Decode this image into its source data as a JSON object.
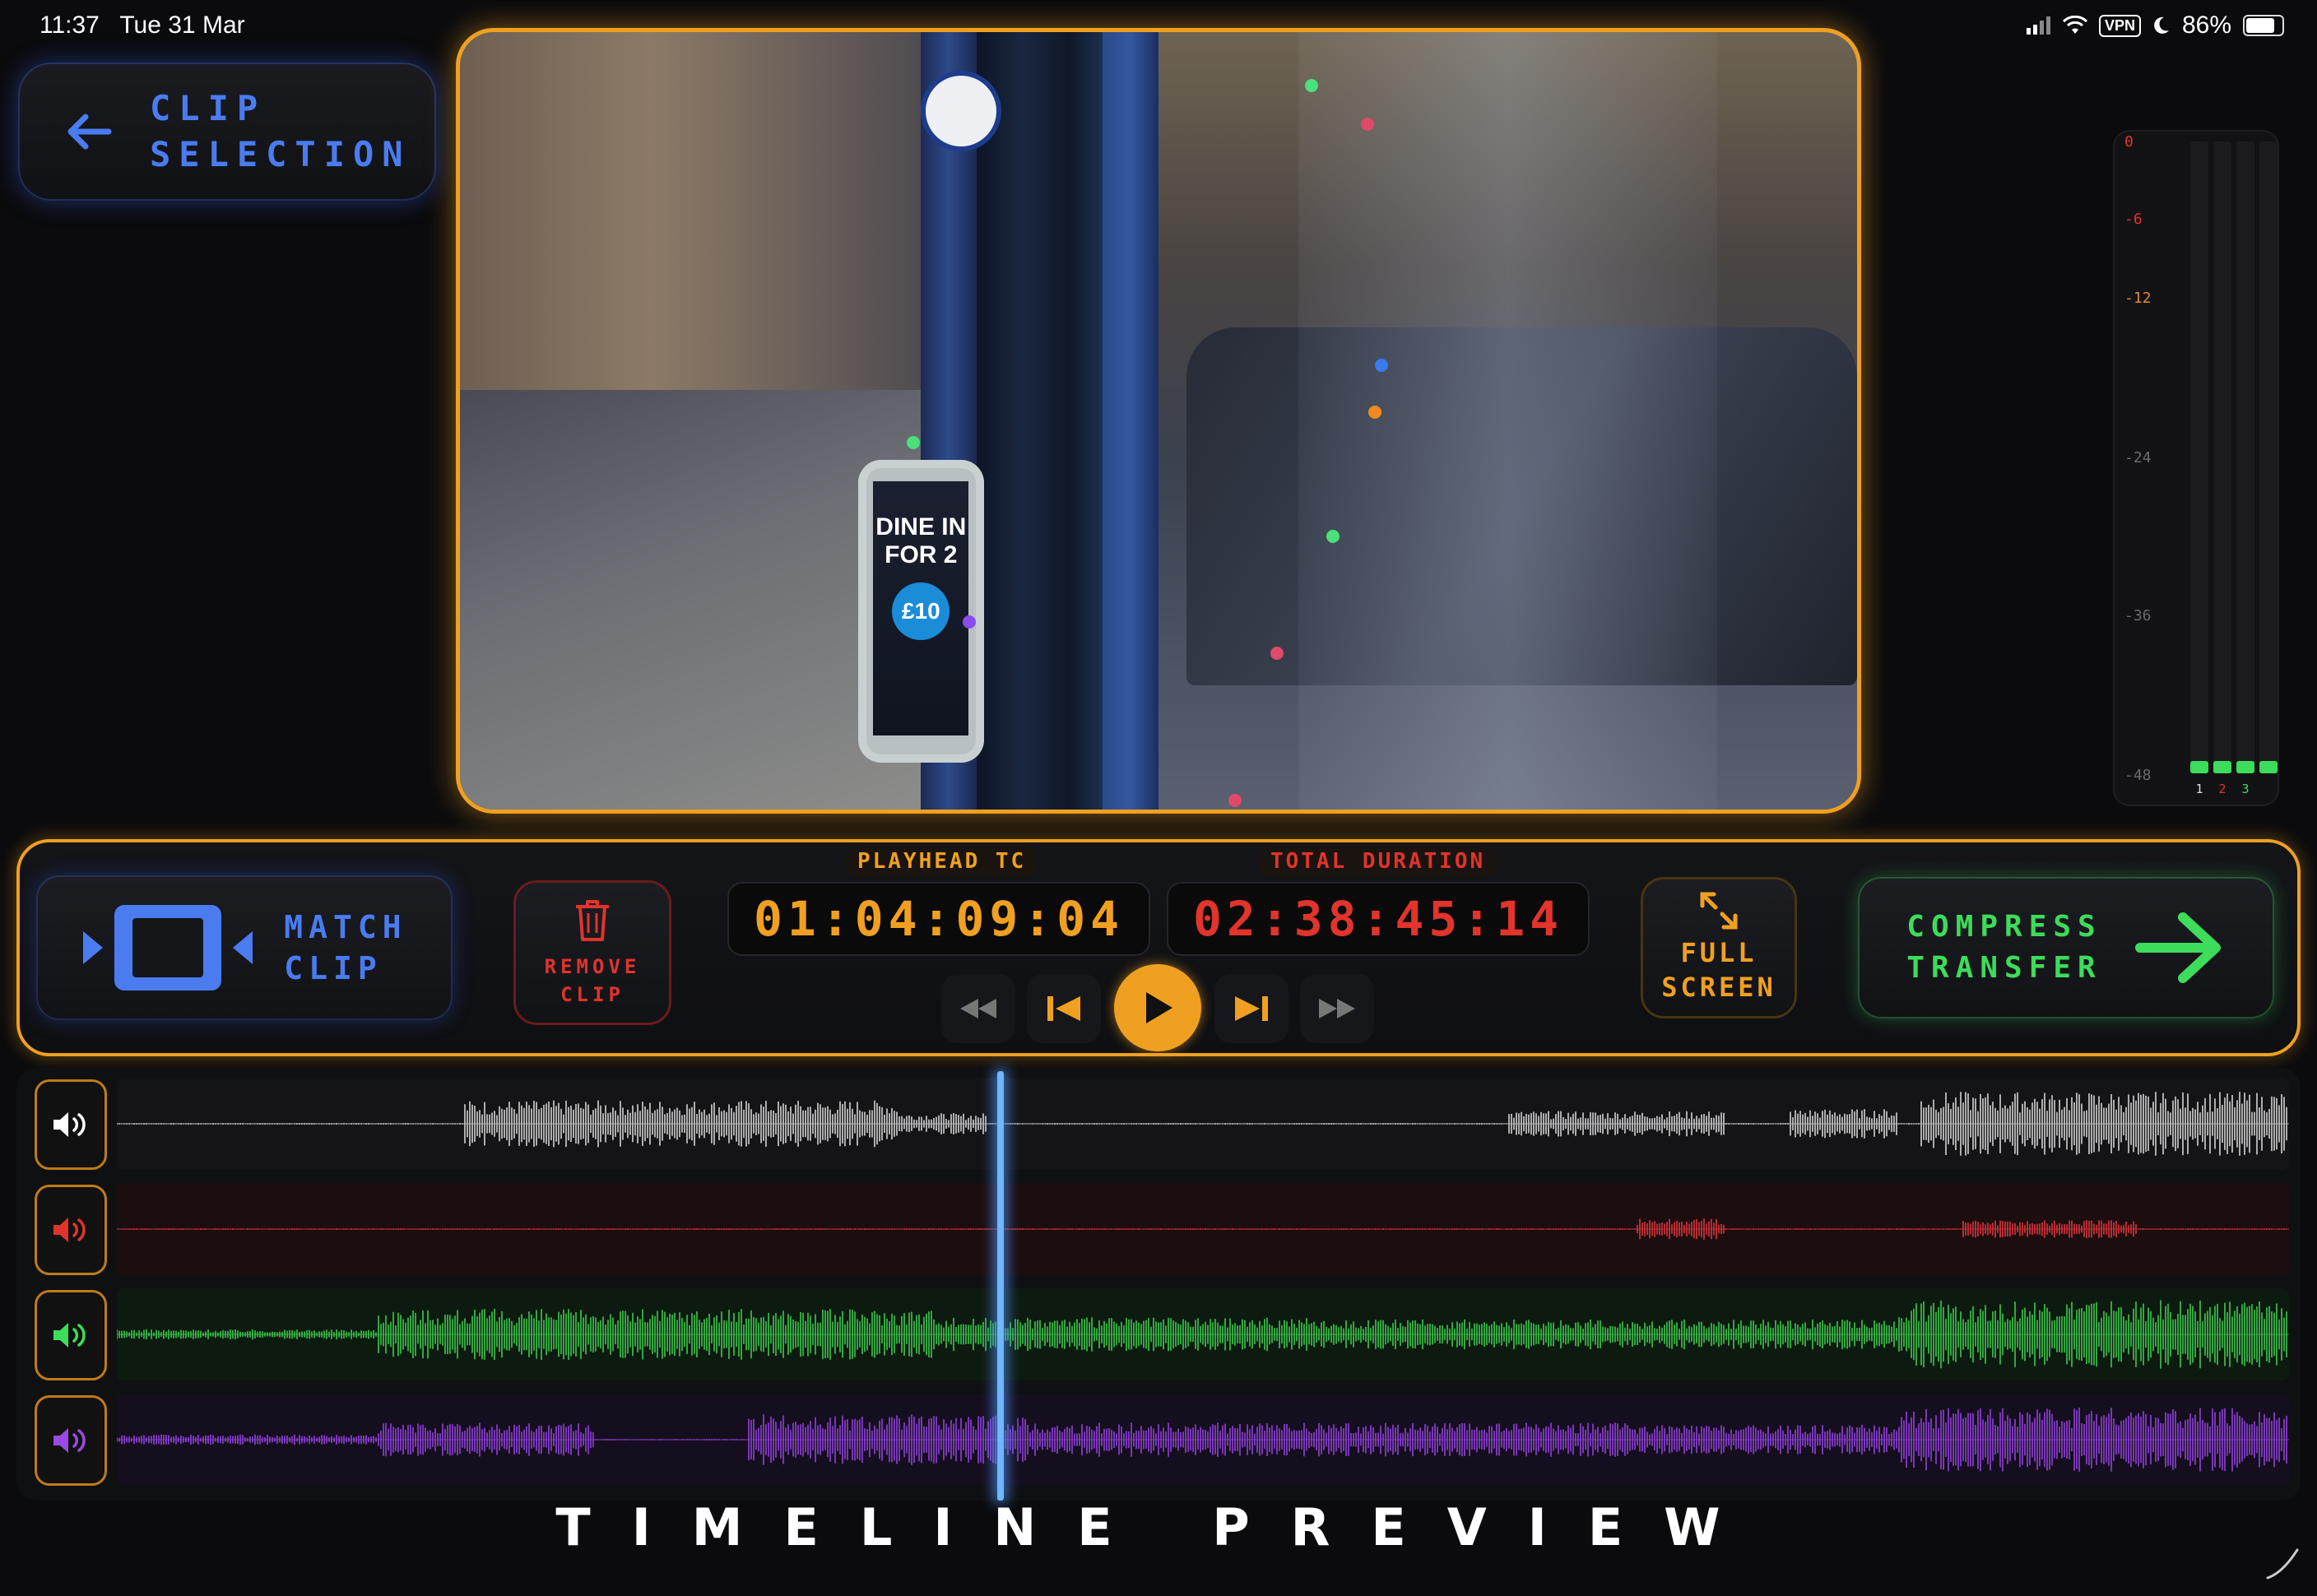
{
  "status_bar": {
    "time": "11:37",
    "date": "Tue 31 Mar",
    "vpn": "VPN",
    "battery": "86%",
    "battery_level": 0.86
  },
  "nav": {
    "back_label": "CLIP\nSELECTION"
  },
  "video": {
    "poster_title": "DINE IN FOR 2",
    "poster_price": "£10"
  },
  "meter": {
    "scale": [
      "0",
      "-6",
      "-12",
      "-24",
      "-36",
      "-48"
    ],
    "scale_colors": [
      "#e0342c",
      "#e0342c",
      "#e08a2c",
      "#6a6a6a",
      "#6a6a6a",
      "#6a6a6a"
    ],
    "channels": [
      {
        "label": "1",
        "level": 0.02,
        "color": "#dddddd"
      },
      {
        "label": "2",
        "level": 0.02,
        "color": "#e0342c"
      },
      {
        "label": "3",
        "level": 0.02,
        "color": "#3ddc5a"
      },
      {
        "label": "",
        "level": 0.02,
        "color": "#3ddc5a"
      }
    ]
  },
  "controls": {
    "match_clip_label": "MATCH\nCLIP",
    "remove_clip_label": "REMOVE\nCLIP",
    "playhead_title": "PLAYHEAD TC",
    "playhead_tc": "01:04:09:04",
    "total_title": "TOTAL DURATION",
    "total_tc": "02:38:45:14",
    "full_screen_label": "FULL\nSCREEN",
    "compress_label": "COMPRESS\nTRANSFER"
  },
  "timeline": {
    "title": "TIMELINE PREVIEW",
    "playhead_position": 0.407,
    "tracks": [
      {
        "name": "track-1",
        "color": "#c8c8c8",
        "bg": "#141416",
        "icon_color": "#ffffff"
      },
      {
        "name": "track-2",
        "color": "#d0343a",
        "bg": "#1c0d0f",
        "icon_color": "#e0342c"
      },
      {
        "name": "track-3",
        "color": "#3bbf4a",
        "bg": "#0d1a0f",
        "icon_color": "#3ddc5a"
      },
      {
        "name": "track-4",
        "color": "#8a3ed0",
        "bg": "#150e1e",
        "icon_color": "#9a4ae0"
      }
    ]
  },
  "colors": {
    "accent_orange": "#f0a020",
    "accent_blue": "#4a7cf0",
    "accent_red": "#e0342c",
    "accent_green": "#3ddc5a"
  }
}
